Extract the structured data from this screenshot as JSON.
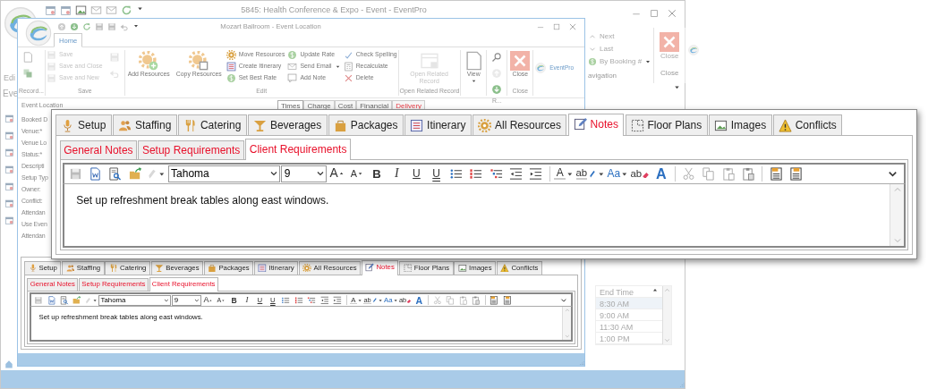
{
  "back_window": {
    "title": "5845: Health Conference & Expo - Event - EventPro",
    "ribbon_label": "Edi",
    "section_label": "Eve",
    "navigation": {
      "items": [
        "Next",
        "Last",
        "By Booking #"
      ],
      "group": "avigation"
    },
    "close": {
      "label": "Close",
      "group": "Close"
    },
    "table": {
      "columns": [
        "End Time"
      ],
      "rows": [
        "8:30 AM",
        "9:00 AM",
        "11:30 AM",
        "1:00 PM"
      ]
    }
  },
  "event_location_window": {
    "title": "Mozart Ballroom - Event Location",
    "ribbon_tabs": [
      {
        "label": "Home",
        "selected": true
      }
    ],
    "ribbon_groups": [
      {
        "label": "Record...",
        "items": [
          {
            "kind": "icon",
            "disabled": false
          },
          {
            "kind": "icon",
            "disabled": false
          }
        ]
      },
      {
        "label": "Save",
        "items": [
          {
            "kind": "small",
            "label": "Save",
            "disabled": true
          },
          {
            "kind": "small",
            "label": "Save and Close",
            "disabled": true
          },
          {
            "kind": "small",
            "label": "Save and New",
            "disabled": true
          },
          {
            "kind": "icon",
            "disabled": true
          },
          {
            "kind": "icon",
            "disabled": true
          }
        ]
      },
      {
        "label": "Edit",
        "items": [
          {
            "kind": "large",
            "label": "Add Resources",
            "disabled": false
          },
          {
            "kind": "large",
            "label": "Copy Resources",
            "disabled": false
          },
          {
            "kind": "small",
            "label": "Move Resources",
            "disabled": false
          },
          {
            "kind": "small",
            "label": "Create Itinerary",
            "disabled": false
          },
          {
            "kind": "small",
            "label": "Set Best Rate",
            "disabled": false
          },
          {
            "kind": "small",
            "label": "Update Rate",
            "disabled": false
          },
          {
            "kind": "small",
            "label": "Send Email",
            "disabled": false,
            "dropdown": true
          },
          {
            "kind": "small",
            "label": "Add Note",
            "disabled": false
          },
          {
            "kind": "small",
            "label": "Check Spelling",
            "disabled": false
          },
          {
            "kind": "small",
            "label": "Recalculate",
            "disabled": false
          },
          {
            "kind": "small",
            "label": "Delete",
            "disabled": false
          }
        ]
      },
      {
        "label": "Open Related Record",
        "items": [
          {
            "kind": "large",
            "label": "Open Related Record",
            "disabled": true
          }
        ]
      },
      {
        "items": [
          {
            "kind": "large",
            "label": "View",
            "disabled": false,
            "dropdown": true
          }
        ]
      },
      {
        "label": "R...",
        "items": [
          {
            "kind": "icon",
            "disabled": false
          },
          {
            "kind": "icon",
            "disabled": true
          },
          {
            "kind": "icon",
            "disabled": false
          }
        ]
      },
      {
        "label": "Close",
        "items": [
          {
            "kind": "large",
            "label": "Close",
            "disabled": false
          }
        ]
      }
    ],
    "logo_text": "EventPro",
    "form": {
      "section": "Event Location",
      "labels": [
        "Booked D",
        "Venue:*",
        "Venue Lo",
        "Status:*",
        "Descripti",
        "Setup Typ",
        "Owner:",
        "Conflict:",
        "Attendan",
        "Use Even",
        "Attendan"
      ],
      "detail_tabs": [
        {
          "label": "Times",
          "selected": true,
          "highlighted": false
        },
        {
          "label": "Charge",
          "selected": false,
          "highlighted": false
        },
        {
          "label": "Cost",
          "selected": false,
          "highlighted": false
        },
        {
          "label": "Financial",
          "selected": false,
          "highlighted": false
        },
        {
          "label": "Delivery",
          "selected": false,
          "highlighted": true
        }
      ]
    },
    "notes_panel": {
      "tabs": [
        {
          "label": "Setup",
          "selected": false
        },
        {
          "label": "Staffing",
          "selected": false
        },
        {
          "label": "Catering",
          "selected": false
        },
        {
          "label": "Beverages",
          "selected": false
        },
        {
          "label": "Packages",
          "selected": false
        },
        {
          "label": "Itinerary",
          "selected": false
        },
        {
          "label": "All Resources",
          "selected": false
        },
        {
          "label": "Notes",
          "selected": true
        },
        {
          "label": "Floor Plans",
          "selected": false
        },
        {
          "label": "Images",
          "selected": false
        },
        {
          "label": "Conflicts",
          "selected": false
        }
      ],
      "subtabs": [
        {
          "label": "General Notes",
          "selected": false
        },
        {
          "label": "Setup Requirements",
          "selected": false
        },
        {
          "label": "Client Requirements",
          "selected": true
        }
      ],
      "toolbar": {
        "font": "Tahoma",
        "size": "9",
        "glyphs": [
          "A",
          "A",
          "B",
          "I",
          "U",
          "U",
          "A",
          "ab",
          "Aa",
          "ab",
          "A"
        ]
      },
      "text": "Set up refreshment break tables along east windows."
    }
  },
  "zoomed_notes_panel": {
    "tabs": [
      {
        "label": "Setup",
        "selected": false
      },
      {
        "label": "Staffing",
        "selected": false
      },
      {
        "label": "Catering",
        "selected": false
      },
      {
        "label": "Beverages",
        "selected": false
      },
      {
        "label": "Packages",
        "selected": false
      },
      {
        "label": "Itinerary",
        "selected": false
      },
      {
        "label": "All Resources",
        "selected": false
      },
      {
        "label": "Notes",
        "selected": true
      },
      {
        "label": "Floor Plans",
        "selected": false
      },
      {
        "label": "Images",
        "selected": false
      },
      {
        "label": "Conflicts",
        "selected": false
      }
    ],
    "subtabs": [
      {
        "label": "General Notes",
        "selected": false
      },
      {
        "label": "Setup Requirements",
        "selected": false
      },
      {
        "label": "Client Requirements",
        "selected": true
      }
    ],
    "toolbar": {
      "font": "Tahoma",
      "size": "9",
      "glyphs": [
        "A",
        "A",
        "B",
        "I",
        "U",
        "U",
        "A",
        "ab",
        "Aa",
        "ab",
        "A"
      ]
    },
    "text": "Set up refreshment break tables along east windows."
  }
}
